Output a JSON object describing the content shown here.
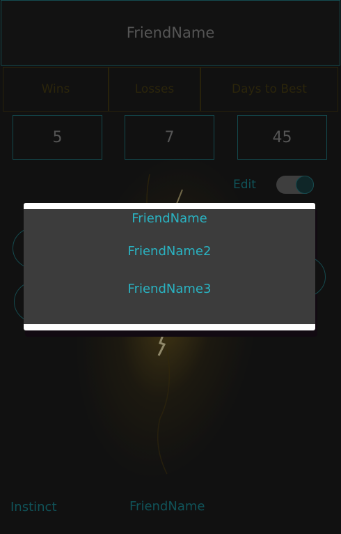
{
  "header": {
    "title": "FriendName"
  },
  "stats": {
    "headers": [
      "Wins",
      "Losses",
      "Days to Best"
    ],
    "values": [
      "5",
      "7",
      "45"
    ]
  },
  "edit": {
    "label": "Edit",
    "enabled": true
  },
  "footer": {
    "left": "Instinct",
    "center": "FriendName"
  },
  "dialog": {
    "items": [
      "FriendName",
      "FriendName2",
      "FriendName3"
    ]
  },
  "colors": {
    "accent": "#2ab3c2",
    "teal_border": "#1e6a70",
    "background": "#191919",
    "dialog_bg": "#3c3c3c"
  }
}
